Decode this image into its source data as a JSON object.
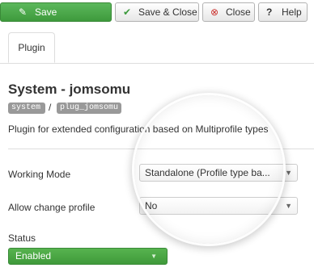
{
  "toolbar": {
    "save": {
      "label": "Save",
      "icon": "edit-icon"
    },
    "save_close": {
      "label": "Save & Close",
      "icon": "check-icon"
    },
    "close": {
      "label": "Close",
      "icon": "close-circle-icon"
    },
    "help": {
      "label": "Help",
      "icon": "help-icon"
    }
  },
  "tabs": [
    {
      "label": "Plugin",
      "active": true
    }
  ],
  "plugin": {
    "title": "System - jomsomu",
    "folder": "system",
    "element": "plug_jomsomu",
    "separator": "/",
    "description": "Plugin for extended configuration based on Multiprofile types"
  },
  "fields": {
    "working_mode": {
      "label": "Working Mode",
      "value": "Standalone (Profile type ba..."
    },
    "allow_change_profile": {
      "label": "Allow change profile",
      "value": "No"
    },
    "status": {
      "label": "Status",
      "value": "Enabled"
    }
  },
  "colors": {
    "save": "#4cae4c",
    "enabled": "#4aa845",
    "tag": "#999999"
  }
}
